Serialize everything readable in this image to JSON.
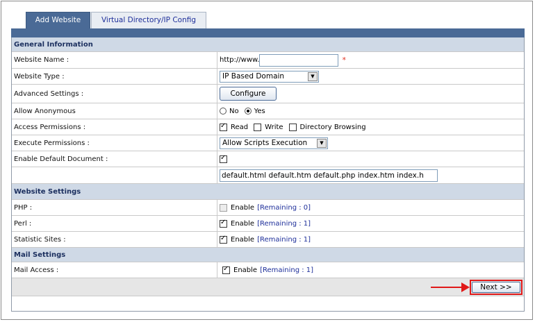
{
  "tabs": [
    {
      "label": "Add Website",
      "active": true
    },
    {
      "label": "Virtual Directory/IP Config",
      "active": false
    }
  ],
  "sections": {
    "general": "General Information",
    "website": "Website Settings",
    "mail": "Mail Settings"
  },
  "general": {
    "website_name": {
      "label": "Website Name :",
      "prefix": "http://www.",
      "value": "",
      "required_mark": "*"
    },
    "website_type": {
      "label": "Website Type :",
      "selected": "IP Based Domain"
    },
    "advanced": {
      "label": "Advanced Settings :",
      "button": "Configure"
    },
    "anonymous": {
      "label": "Allow Anonymous",
      "opt_no": "No",
      "opt_yes": "Yes",
      "selected": "Yes"
    },
    "access": {
      "label": "Access Permissions :",
      "read": "Read",
      "write": "Write",
      "browse": "Directory Browsing"
    },
    "execute": {
      "label": "Execute Permissions :",
      "selected": "Allow Scripts Execution"
    },
    "default_doc": {
      "label": "Enable Default Document :",
      "value": "default.html default.htm default.php index.htm index.h"
    }
  },
  "website": {
    "php": {
      "label": "PHP :",
      "enable": "Enable",
      "remaining": "[Remaining : 0]"
    },
    "perl": {
      "label": "Perl :",
      "enable": "Enable",
      "remaining": "[Remaining : 1]"
    },
    "stats": {
      "label": "Statistic Sites :",
      "enable": "Enable",
      "remaining": "[Remaining : 1]"
    }
  },
  "mail": {
    "access": {
      "label": "Mail Access :",
      "enable": "Enable",
      "remaining": "[Remaining : 1]"
    }
  },
  "footer": {
    "next_label": "Next >>"
  },
  "colors": {
    "header": "#4a6a96",
    "section_bg": "#cfd9e6",
    "link": "#1e2f9a",
    "highlight": "#e01818"
  }
}
